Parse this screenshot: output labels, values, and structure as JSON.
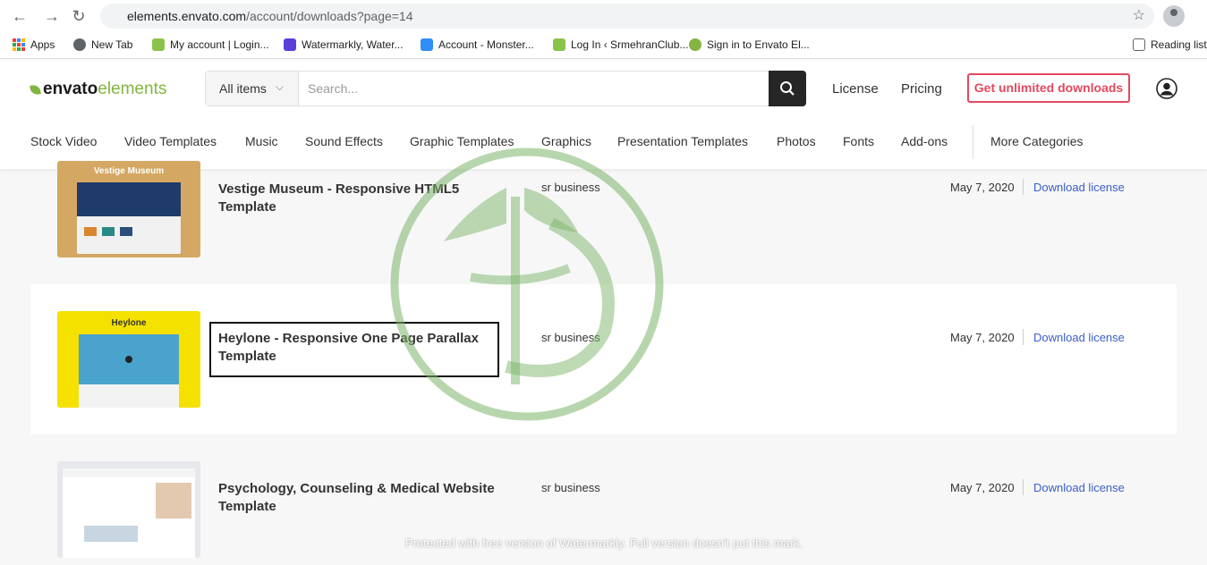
{
  "browser": {
    "url_host": "elements.envato.com",
    "url_path": "/account/downloads?page=14",
    "bookmarks": [
      {
        "label": "Apps"
      },
      {
        "label": "New Tab"
      },
      {
        "label": "My account | Login..."
      },
      {
        "label": "Watermarkly, Water..."
      },
      {
        "label": "Account - Monster..."
      },
      {
        "label": "Log In ‹ SrmehranClub..."
      },
      {
        "label": "Sign in to Envato El..."
      },
      {
        "label": "Reading list"
      }
    ]
  },
  "header": {
    "logo_part1": "envato",
    "logo_part2": "elements",
    "category_select": "All items",
    "search_placeholder": "Search...",
    "license": "License",
    "pricing": "Pricing",
    "cta": "Get unlimited downloads"
  },
  "categories": [
    "Stock Video",
    "Video Templates",
    "Music",
    "Sound Effects",
    "Graphic Templates",
    "Graphics",
    "Presentation Templates",
    "Photos",
    "Fonts",
    "Add-ons",
    "More Categories"
  ],
  "downloads": [
    {
      "title": "Vestige Museum - Responsive HTML5 Template",
      "author": "sr business",
      "date": "May 7, 2020",
      "link": "Download license",
      "thumb_title": "Vestige Museum"
    },
    {
      "title": "Heylone - Responsive One Page Parallax Template",
      "author": "sr business",
      "date": "May 7, 2020",
      "link": "Download license",
      "thumb_title": "Heylone"
    },
    {
      "title": "Psychology, Counseling & Medical Website Template",
      "author": "sr business",
      "date": "May 7, 2020",
      "link": "Download license",
      "thumb_title": ""
    }
  ],
  "watermark_text": "Protected with free version of Watermarkly. Full version doesn't put this mark.",
  "colors": {
    "accent_green": "#82b541",
    "cta_red": "#e5485f",
    "link_blue": "#3b5ec8"
  }
}
